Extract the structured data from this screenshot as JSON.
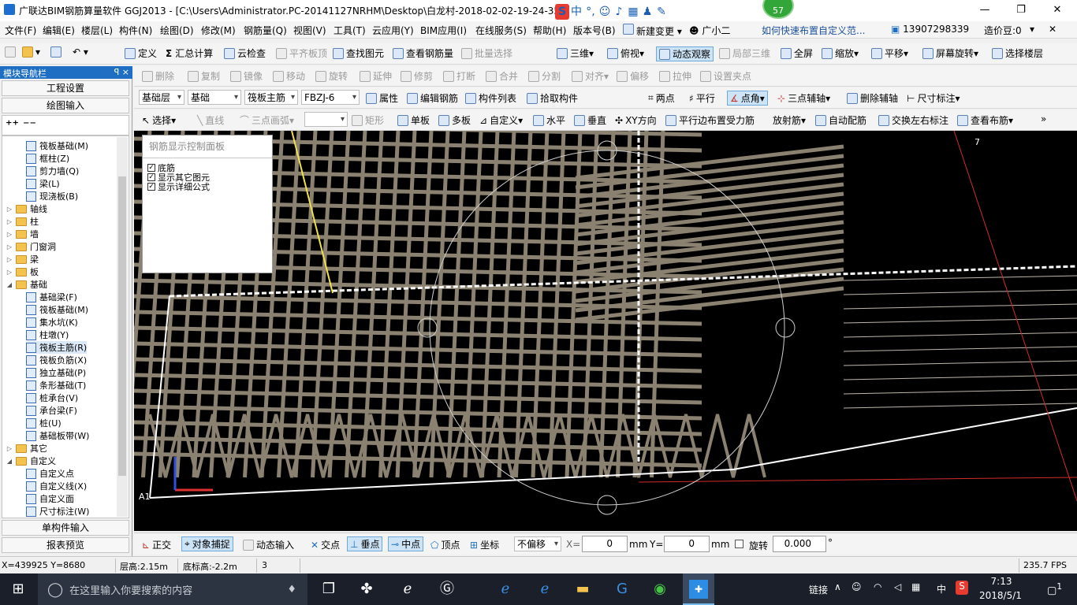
{
  "title": "广联达BIM钢筋算量软件 GGJ2013 - [C:\\Users\\Administrator.PC-20141127NRHM\\Desktop\\白龙村-2018-02-02-19-24-35",
  "badge_count": "57",
  "ad_text": "如何快速布置自定义范...",
  "user_phone": "13907298339",
  "cost_beans": "造价豆:0",
  "menu": [
    "文件(F)",
    "编辑(E)",
    "楼层(L)",
    "构件(N)",
    "绘图(D)",
    "修改(M)",
    "钢筋量(Q)",
    "视图(V)",
    "工具(T)",
    "云应用(Y)",
    "BIM应用(I)",
    "在线服务(S)",
    "帮助(H)",
    "版本号(B)",
    "新建变更",
    "广小二"
  ],
  "toolbar1": [
    "定义",
    "汇总计算",
    "云检查",
    "平齐板顶",
    "查找图元",
    "查看钢筋量",
    "批量选择",
    "三维",
    "俯视",
    "动态观察",
    "局部三维",
    "全屏",
    "缩放",
    "平移",
    "屏幕旋转",
    "选择楼层"
  ],
  "toolbar2": [
    "删除",
    "复制",
    "镜像",
    "移动",
    "旋转",
    "延伸",
    "修剪",
    "打断",
    "合并",
    "分割",
    "对齐",
    "偏移",
    "拉伸",
    "设置夹点"
  ],
  "toolbar3": {
    "floor": "基础层",
    "category": "基础",
    "element_type": "筏板主筋",
    "element_name": "FBZJ-6",
    "buttons": [
      "属性",
      "编辑钢筋",
      "构件列表",
      "拾取构件"
    ],
    "axis_buttons": [
      "两点",
      "平行",
      "点角",
      "三点辅轴",
      "删除辅轴",
      "尺寸标注"
    ]
  },
  "toolbar4": [
    "选择",
    "直线",
    "三点画弧",
    "矩形",
    "单板",
    "多板",
    "自定义",
    "水平",
    "垂直",
    "XY方向",
    "平行边布置受力筋",
    "放射筋",
    "自动配筋",
    "交换左右标注",
    "查看布筋"
  ],
  "nav": {
    "header": "模块导航栏",
    "pin": "ꟼ ×",
    "project_settings": "工程设置",
    "drawing_input": "绘图输入",
    "single_input": "单构件输入",
    "report_preview": "报表预览",
    "tree": [
      {
        "label": "筏板基础(M)",
        "level": 2,
        "type": "item"
      },
      {
        "label": "框柱(Z)",
        "level": 2,
        "type": "item"
      },
      {
        "label": "剪力墙(Q)",
        "level": 2,
        "type": "item"
      },
      {
        "label": "梁(L)",
        "level": 2,
        "type": "item"
      },
      {
        "label": "现浇板(B)",
        "level": 2,
        "type": "item"
      },
      {
        "label": "轴线",
        "level": 1,
        "type": "folder",
        "exp": "▷"
      },
      {
        "label": "柱",
        "level": 1,
        "type": "folder",
        "exp": "▷"
      },
      {
        "label": "墙",
        "level": 1,
        "type": "folder",
        "exp": "▷"
      },
      {
        "label": "门窗洞",
        "level": 1,
        "type": "folder",
        "exp": "▷"
      },
      {
        "label": "梁",
        "level": 1,
        "type": "folder",
        "exp": "▷"
      },
      {
        "label": "板",
        "level": 1,
        "type": "folder",
        "exp": "▷"
      },
      {
        "label": "基础",
        "level": 1,
        "type": "folder",
        "exp": "◢"
      },
      {
        "label": "基础梁(F)",
        "level": 2,
        "type": "item"
      },
      {
        "label": "筏板基础(M)",
        "level": 2,
        "type": "item"
      },
      {
        "label": "集水坑(K)",
        "level": 2,
        "type": "item"
      },
      {
        "label": "柱墩(Y)",
        "level": 2,
        "type": "item"
      },
      {
        "label": "筏板主筋(R)",
        "level": 2,
        "type": "item",
        "selected": true
      },
      {
        "label": "筏板负筋(X)",
        "level": 2,
        "type": "item"
      },
      {
        "label": "独立基础(P)",
        "level": 2,
        "type": "item"
      },
      {
        "label": "条形基础(T)",
        "level": 2,
        "type": "item"
      },
      {
        "label": "桩承台(V)",
        "level": 2,
        "type": "item"
      },
      {
        "label": "承台梁(F)",
        "level": 2,
        "type": "item"
      },
      {
        "label": "桩(U)",
        "level": 2,
        "type": "item"
      },
      {
        "label": "基础板带(W)",
        "level": 2,
        "type": "item"
      },
      {
        "label": "其它",
        "level": 1,
        "type": "folder",
        "exp": "▷"
      },
      {
        "label": "自定义",
        "level": 1,
        "type": "folder",
        "exp": "◢"
      },
      {
        "label": "自定义点",
        "level": 2,
        "type": "item"
      },
      {
        "label": "自定义线(X)",
        "level": 2,
        "type": "item"
      },
      {
        "label": "自定义面",
        "level": 2,
        "type": "item"
      },
      {
        "label": "尺寸标注(W)",
        "level": 2,
        "type": "item"
      }
    ]
  },
  "rebar_panel": {
    "title": "钢筋显示控制面板",
    "options": [
      {
        "label": "底筋",
        "checked": true
      },
      {
        "label": "显示其它图元",
        "checked": true
      },
      {
        "label": "显示详细公式",
        "checked": true
      }
    ]
  },
  "canvas_labels": {
    "axis_a1": "A1",
    "axis_7": "7"
  },
  "snap": {
    "ortho": "正交",
    "object_snap": "对象捕捉",
    "dynamic_input": "动态输入",
    "intersection": "交点",
    "perpendicular": "垂点",
    "midpoint": "中点",
    "vertex": "顶点",
    "coordinate": "坐标",
    "offset_mode": "不偏移",
    "x_label": "X=",
    "x_value": "0",
    "mm1": "mm",
    "y_label": "Y=",
    "y_value": "0",
    "mm2": "mm",
    "rotate_label": "旋转",
    "rotate_value": "0.000",
    "degree": "°"
  },
  "status": {
    "coords": "X=439925 Y=8680",
    "floor_height": "层高:2.15m",
    "base_height": "底标高:-2.2m",
    "count": "3",
    "fps": "235.7 FPS"
  },
  "taskbar": {
    "search_placeholder": "在这里输入你要搜索的内容",
    "link": "链接",
    "lang": "中",
    "time": "7:13",
    "date": "2018/5/1",
    "notif": "1"
  },
  "colors": {
    "accent": "#1e6fc3",
    "canvas": "#000000",
    "rebar": "#8b8170",
    "titlebar_bg": "#ffffff",
    "taskbar": "#1a1f29"
  }
}
